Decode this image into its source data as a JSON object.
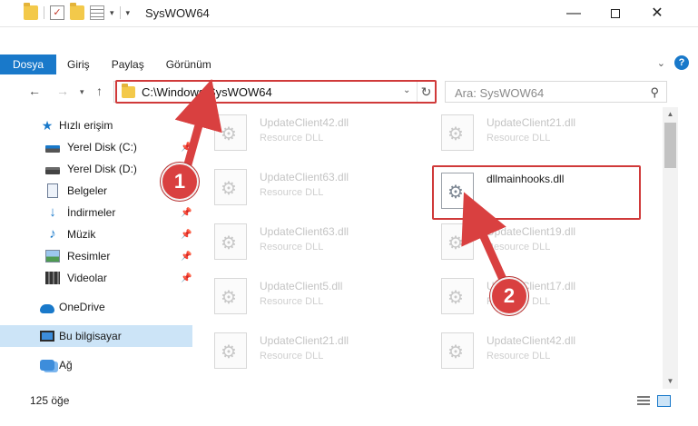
{
  "window": {
    "title": "SysWOW64",
    "minimize": "—",
    "close": "✕"
  },
  "quick_access_toolbar": {
    "dropdown": "▾",
    "check": "✓"
  },
  "ribbon": {
    "tabs": [
      "Dosya",
      "Giriş",
      "Paylaş",
      "Görünüm"
    ],
    "collapse": "⌄",
    "help": "?"
  },
  "navigation": {
    "back": "←",
    "forward": "→",
    "history": "▾",
    "up": "↑",
    "address": "C:\\Windows\\SysWOW64",
    "address_dropdown": "⌄",
    "refresh": "↻",
    "search_placeholder": "Ara: SysWOW64",
    "search_icon": "⚲"
  },
  "sidebar": {
    "items": [
      {
        "label": "Hızlı erişim",
        "icon": "star-icon"
      },
      {
        "label": "Yerel Disk (C:)",
        "icon": "drive-c-icon"
      },
      {
        "label": "Yerel Disk (D:)",
        "icon": "drive-d-icon"
      },
      {
        "label": "Belgeler",
        "icon": "documents-icon"
      },
      {
        "label": "İndirmeler",
        "icon": "downloads-icon"
      },
      {
        "label": "Müzik",
        "icon": "music-icon"
      },
      {
        "label": "Resimler",
        "icon": "pictures-icon"
      },
      {
        "label": "Videolar",
        "icon": "videos-icon"
      },
      {
        "label": "OneDrive",
        "icon": "onedrive-icon"
      },
      {
        "label": "Bu bilgisayar",
        "icon": "this-pc-icon"
      },
      {
        "label": "Ağ",
        "icon": "network-icon"
      }
    ],
    "pin": "📌"
  },
  "files": {
    "left_column": [
      {
        "name": "UpdateClient42.dll",
        "type": "Resource DLL"
      },
      {
        "name": "UpdateClient63.dll",
        "type": "Resource DLL"
      },
      {
        "name": "UpdateClient63.dll",
        "type": "Resource DLL"
      },
      {
        "name": "UpdateClient5.dll",
        "type": "Resource DLL"
      },
      {
        "name": "UpdateClient21.dll",
        "type": "Resource DLL"
      }
    ],
    "right_column": [
      {
        "name": "UpdateClient21.dll",
        "type": "Resource DLL"
      },
      {
        "name": "dllmainhooks.dll",
        "type": ""
      },
      {
        "name": "UpdateClient19.dll",
        "type": "Resource DLL"
      },
      {
        "name": "UpdateClient17.dll",
        "type": "Resource DLL"
      },
      {
        "name": "UpdateClient42.dll",
        "type": "Resource DLL"
      }
    ]
  },
  "status_bar": {
    "item_count": "125 öğe"
  },
  "annotations": {
    "step1": "1",
    "step2": "2",
    "color": "#d94040"
  },
  "colors": {
    "accent": "#1979ca",
    "selection": "#cce4f7",
    "highlight_border": "#d03a3a"
  }
}
